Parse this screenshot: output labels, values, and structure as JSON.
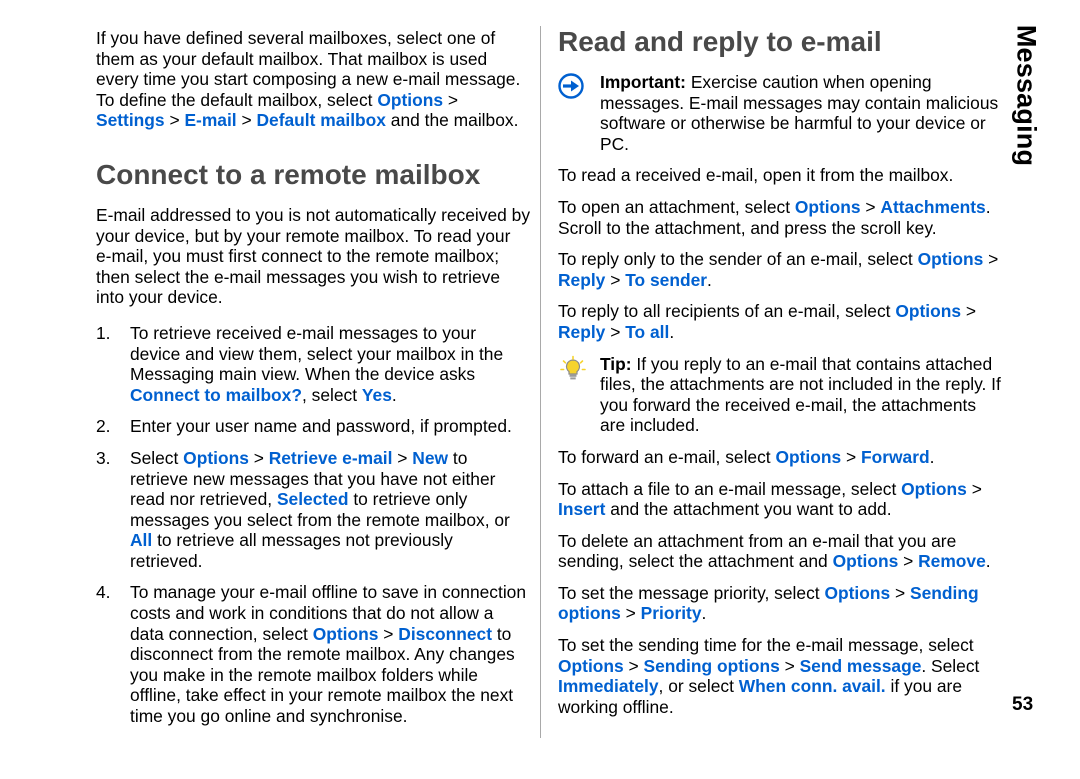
{
  "sidebar": {
    "chapter_label": "Messaging"
  },
  "page_number": "53",
  "left_column": {
    "intro_paragraph_parts": [
      {
        "t": "If you have defined several mailboxes, select one of them as your default mailbox. That mailbox is used every time you start composing a new e-mail message. To define the default mailbox, select ",
        "s": "plain"
      },
      {
        "t": "Options",
        "s": "blue"
      },
      {
        "t": " > ",
        "s": "plain"
      },
      {
        "t": "Settings",
        "s": "blue"
      },
      {
        "t": " > ",
        "s": "plain"
      },
      {
        "t": "E-mail",
        "s": "blue"
      },
      {
        "t": " > ",
        "s": "plain"
      },
      {
        "t": "Default mailbox",
        "s": "blue"
      },
      {
        "t": " and the mailbox.",
        "s": "plain"
      }
    ],
    "heading": "Connect to a remote mailbox",
    "body_paragraph": "E-mail addressed to you is not automatically received by your device, but by your remote mailbox. To read your e-mail, you must first connect to the remote mailbox; then select the e-mail messages you wish to retrieve into your device.",
    "steps": [
      {
        "number": "1.",
        "parts": [
          {
            "t": "To retrieve received e-mail messages to your device and view them, select your mailbox in the Messaging main view. When the device asks ",
            "s": "plain"
          },
          {
            "t": "Connect to mailbox?",
            "s": "blue"
          },
          {
            "t": ", select ",
            "s": "plain"
          },
          {
            "t": "Yes",
            "s": "blue"
          },
          {
            "t": ".",
            "s": "plain"
          }
        ]
      },
      {
        "number": "2.",
        "parts": [
          {
            "t": "Enter your user name and password, if prompted.",
            "s": "plain"
          }
        ]
      },
      {
        "number": "3.",
        "parts": [
          {
            "t": "Select ",
            "s": "plain"
          },
          {
            "t": "Options",
            "s": "blue"
          },
          {
            "t": " > ",
            "s": "plain"
          },
          {
            "t": "Retrieve e-mail",
            "s": "blue"
          },
          {
            "t": " > ",
            "s": "plain"
          },
          {
            "t": "New",
            "s": "blue"
          },
          {
            "t": " to retrieve new messages that you have not either read nor retrieved, ",
            "s": "plain"
          },
          {
            "t": "Selected",
            "s": "blue"
          },
          {
            "t": " to retrieve only messages you select from the remote mailbox, or ",
            "s": "plain"
          },
          {
            "t": "All",
            "s": "blue"
          },
          {
            "t": " to retrieve all messages not previously retrieved.",
            "s": "plain"
          }
        ]
      },
      {
        "number": "4.",
        "parts": [
          {
            "t": "To manage your e-mail offline to save in connection costs and work in conditions that do not allow a data connection, select ",
            "s": "plain"
          },
          {
            "t": "Options",
            "s": "blue"
          },
          {
            "t": " > ",
            "s": "plain"
          },
          {
            "t": "Disconnect",
            "s": "blue"
          },
          {
            "t": " to disconnect from the remote mailbox. Any changes you make in the remote mailbox folders while offline, take effect in your remote mailbox the next time you go online and synchronise.",
            "s": "plain"
          }
        ]
      }
    ]
  },
  "right_column": {
    "heading": "Read and reply to e-mail",
    "important_note": {
      "icon": "important-icon",
      "parts": [
        {
          "t": "Important:",
          "s": "bold"
        },
        {
          "t": "  Exercise caution when opening messages. E-mail messages may contain malicious software or otherwise be harmful to your device or PC.",
          "s": "plain"
        }
      ]
    },
    "paragraphs": [
      {
        "parts": [
          {
            "t": "To read a received e-mail, open it from the mailbox.",
            "s": "plain"
          }
        ]
      },
      {
        "parts": [
          {
            "t": "To open an attachment, select ",
            "s": "plain"
          },
          {
            "t": "Options",
            "s": "blue"
          },
          {
            "t": " > ",
            "s": "plain"
          },
          {
            "t": "Attachments",
            "s": "blue"
          },
          {
            "t": ". Scroll to the attachment, and press the scroll key.",
            "s": "plain"
          }
        ]
      },
      {
        "parts": [
          {
            "t": "To reply only to the sender of an e-mail, select ",
            "s": "plain"
          },
          {
            "t": "Options",
            "s": "blue"
          },
          {
            "t": " > ",
            "s": "plain"
          },
          {
            "t": "Reply",
            "s": "blue"
          },
          {
            "t": " > ",
            "s": "plain"
          },
          {
            "t": "To sender",
            "s": "blue"
          },
          {
            "t": ".",
            "s": "plain"
          }
        ]
      },
      {
        "parts": [
          {
            "t": "To reply to all recipients of an e-mail, select ",
            "s": "plain"
          },
          {
            "t": "Options",
            "s": "blue"
          },
          {
            "t": " > ",
            "s": "plain"
          },
          {
            "t": "Reply",
            "s": "blue"
          },
          {
            "t": " > ",
            "s": "plain"
          },
          {
            "t": "To all",
            "s": "blue"
          },
          {
            "t": ".",
            "s": "plain"
          }
        ]
      }
    ],
    "tip_note": {
      "icon": "tip-bulb-icon",
      "parts": [
        {
          "t": "Tip:",
          "s": "bold"
        },
        {
          "t": " If you reply to an e-mail that contains attached files, the attachments are not included in the reply. If you forward the received e-mail, the attachments are included.",
          "s": "plain"
        }
      ]
    },
    "paragraphs2": [
      {
        "parts": [
          {
            "t": "To forward an e-mail, select ",
            "s": "plain"
          },
          {
            "t": "Options",
            "s": "blue"
          },
          {
            "t": " > ",
            "s": "plain"
          },
          {
            "t": "Forward",
            "s": "blue"
          },
          {
            "t": ".",
            "s": "plain"
          }
        ]
      },
      {
        "parts": [
          {
            "t": "To attach a file to an e-mail message, select ",
            "s": "plain"
          },
          {
            "t": "Options",
            "s": "blue"
          },
          {
            "t": " > ",
            "s": "plain"
          },
          {
            "t": "Insert",
            "s": "blue"
          },
          {
            "t": " and the attachment you want to add.",
            "s": "plain"
          }
        ]
      },
      {
        "parts": [
          {
            "t": "To delete an attachment from an e-mail that you are sending, select the attachment and ",
            "s": "plain"
          },
          {
            "t": "Options",
            "s": "blue"
          },
          {
            "t": " > ",
            "s": "plain"
          },
          {
            "t": "Remove",
            "s": "blue"
          },
          {
            "t": ".",
            "s": "plain"
          }
        ]
      },
      {
        "parts": [
          {
            "t": "To set the message priority, select ",
            "s": "plain"
          },
          {
            "t": "Options",
            "s": "blue"
          },
          {
            "t": " > ",
            "s": "plain"
          },
          {
            "t": "Sending options",
            "s": "blue"
          },
          {
            "t": " > ",
            "s": "plain"
          },
          {
            "t": "Priority",
            "s": "blue"
          },
          {
            "t": ".",
            "s": "plain"
          }
        ]
      },
      {
        "parts": [
          {
            "t": "To set the sending time for the e-mail message, select ",
            "s": "plain"
          },
          {
            "t": "Options",
            "s": "blue"
          },
          {
            "t": " > ",
            "s": "plain"
          },
          {
            "t": "Sending options",
            "s": "blue"
          },
          {
            "t": " > ",
            "s": "plain"
          },
          {
            "t": "Send message",
            "s": "blue"
          },
          {
            "t": ". Select ",
            "s": "plain"
          },
          {
            "t": "Immediately",
            "s": "blue"
          },
          {
            "t": ", or select ",
            "s": "plain"
          },
          {
            "t": "When conn. avail.",
            "s": "blue"
          },
          {
            "t": " if you are working offline.",
            "s": "plain"
          }
        ]
      }
    ]
  }
}
